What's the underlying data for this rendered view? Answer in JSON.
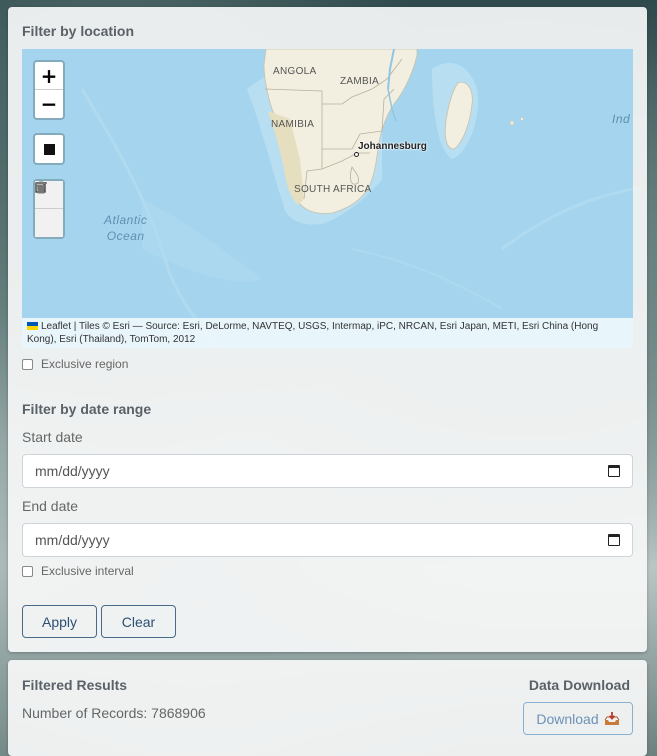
{
  "location_filter": {
    "title": "Filter by location",
    "map": {
      "zoom_in": "+",
      "zoom_out": "−",
      "labels": {
        "angola": "ANGOLA",
        "zambia": "ZAMBIA",
        "namibia": "NAMIBIA",
        "south_africa": "SOUTH AFRICA",
        "atlantic": "Atlantic",
        "ocean": "Ocean",
        "indian": "Ind",
        "johannesburg": "Johannesburg"
      },
      "attribution": "Leaflet | Tiles © Esri — Source: Esri, DeLorme, NAVTEQ, USGS, Intermap, iPC, NRCAN, Esri Japan, METI, Esri China (Hong Kong), Esri (Thailand), TomTom, 2012"
    },
    "exclusive_region_label": "Exclusive region"
  },
  "date_filter": {
    "title": "Filter by date range",
    "start_label": "Start date",
    "start_value": "mm/dd/yyyy",
    "end_label": "End date",
    "end_value": "mm/dd/yyyy",
    "exclusive_interval_label": "Exclusive interval"
  },
  "actions": {
    "apply": "Apply",
    "clear": "Clear"
  },
  "results": {
    "title": "Filtered Results",
    "records_label": "Number of Records: 7868906"
  },
  "download": {
    "title": "Data Download",
    "button": "Download"
  },
  "colors": {
    "ocean": "#a5d5ee",
    "land": "#f2efe1",
    "button_border": "#4a6a8a"
  }
}
